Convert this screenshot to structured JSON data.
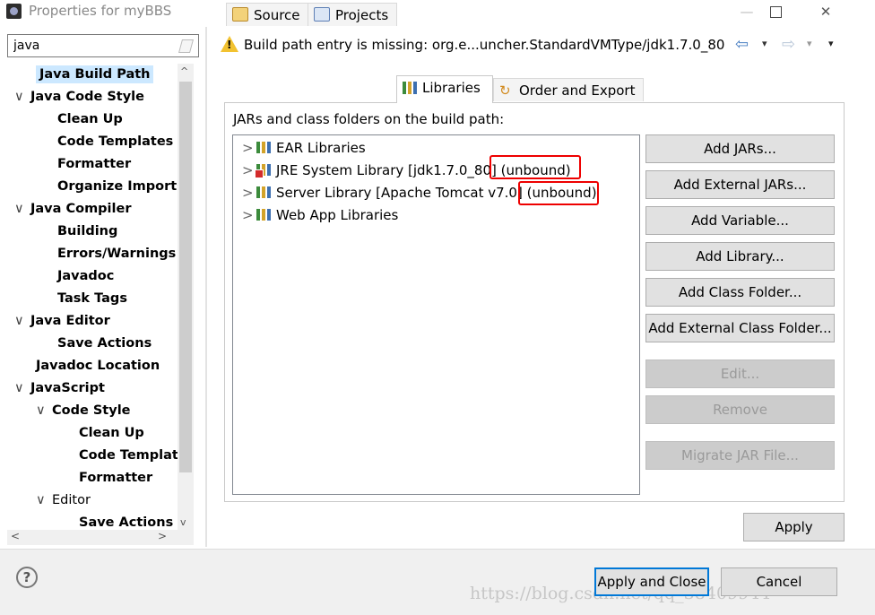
{
  "window": {
    "title": "Properties for myBBS",
    "minimize": "—",
    "close": "✕"
  },
  "filter": {
    "value": "java"
  },
  "tree": [
    {
      "label": "Java Build Path",
      "selected": true
    },
    {
      "label": "Java Code Style",
      "chevron": "∨"
    },
    {
      "label": "Clean Up"
    },
    {
      "label": "Code Templates"
    },
    {
      "label": "Formatter"
    },
    {
      "label": "Organize Imports"
    },
    {
      "label": "Java Compiler",
      "chevron": "∨"
    },
    {
      "label": "Building"
    },
    {
      "label": "Errors/Warnings"
    },
    {
      "label": "Javadoc"
    },
    {
      "label": "Task Tags"
    },
    {
      "label": "Java Editor",
      "chevron": "∨"
    },
    {
      "label": "Save Actions"
    },
    {
      "label": "Javadoc Location"
    },
    {
      "label": "JavaScript",
      "chevron": "∨"
    },
    {
      "label": "Code Style",
      "chevron": "∨"
    },
    {
      "label": "Clean Up"
    },
    {
      "label": "Code Templat"
    },
    {
      "label": "Formatter"
    },
    {
      "label": "Editor",
      "chevron": "∨"
    },
    {
      "label": "Save Actions"
    }
  ],
  "scroll": {
    "up": "^",
    "down": "v",
    "left": "<",
    "right": ">"
  },
  "message": {
    "text": "Build path entry is missing: org.e...uncher.StandardVMType/jdk1.7.0_80",
    "icon": "warning-icon",
    "back": "⇦",
    "forward": "⇨",
    "dropdown": "▾",
    "menu": "▾"
  },
  "tabs": [
    {
      "label": "Source",
      "icon": "source-folder-icon"
    },
    {
      "label": "Projects",
      "icon": "projects-icon"
    },
    {
      "label": "Libraries",
      "icon": "library-icon",
      "active": true
    },
    {
      "label": "Order and Export",
      "icon": "order-export-icon"
    }
  ],
  "libraries_label": "JARs and class folders on the build path:",
  "libraries": [
    {
      "name": "EAR Libraries",
      "suffix": "",
      "error": false
    },
    {
      "name": "JRE System Library [jdk1.7.0_80]",
      "suffix": " (unbound)",
      "error": true
    },
    {
      "name": "Server Library [Apache Tomcat v7.0]",
      "suffix": " (unbound)",
      "error": false
    },
    {
      "name": "Web App Libraries",
      "suffix": "",
      "error": false
    }
  ],
  "chevron_right": ">",
  "buttons": [
    {
      "label": "Add JARs...",
      "enabled": true
    },
    {
      "label": "Add External JARs...",
      "enabled": true
    },
    {
      "label": "Add Variable...",
      "enabled": true
    },
    {
      "label": "Add Library...",
      "enabled": true
    },
    {
      "label": "Add Class Folder...",
      "enabled": true
    },
    {
      "label": "Add External Class Folder...",
      "enabled": true
    },
    {
      "label": "Edit...",
      "enabled": false
    },
    {
      "label": "Remove",
      "enabled": false
    },
    {
      "label": "Migrate JAR File...",
      "enabled": false
    }
  ],
  "apply": "Apply",
  "footer": {
    "help": "?",
    "apply_close": "Apply and Close",
    "cancel": "Cancel",
    "watermark": "https://blog.csdn.net/qq_38409944"
  }
}
